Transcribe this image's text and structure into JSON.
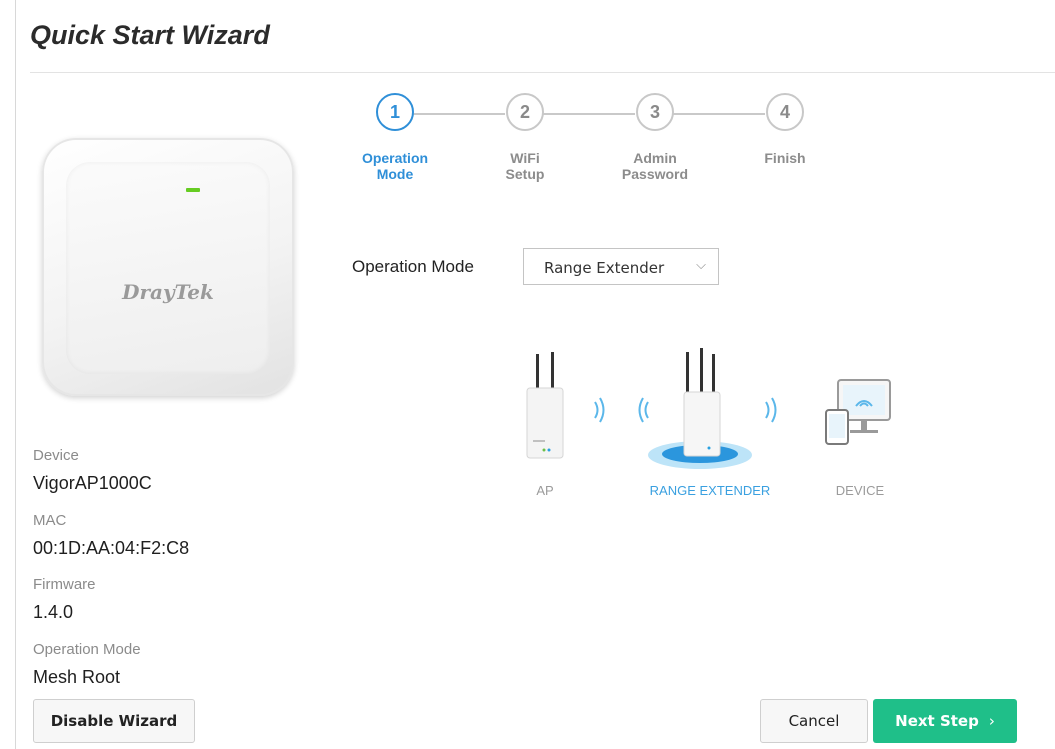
{
  "page": {
    "title": "Quick Start Wizard"
  },
  "device_image": {
    "logo_text": "DrayTek",
    "led_color": "#66cc22"
  },
  "info": [
    {
      "label": "Device",
      "value": "VigorAP1000C"
    },
    {
      "label": "MAC",
      "value": "00:1D:AA:04:F2:C8"
    },
    {
      "label": "Firmware",
      "value": "1.4.0"
    },
    {
      "label": "Operation Mode",
      "value": "Mesh Root"
    }
  ],
  "steps": [
    {
      "number": "1",
      "line1": "Operation",
      "line2": "Mode",
      "active": true
    },
    {
      "number": "2",
      "line1": "WiFi",
      "line2": "Setup",
      "active": false
    },
    {
      "number": "3",
      "line1": "Admin",
      "line2": "Password",
      "active": false
    },
    {
      "number": "4",
      "line1": "Finish",
      "line2": "",
      "active": false
    }
  ],
  "form": {
    "operation_mode_label": "Operation Mode",
    "operation_mode_value": "Range Extender"
  },
  "illustration": {
    "captions": [
      "AP",
      "RANGE EXTENDER",
      "DEVICE"
    ]
  },
  "buttons": {
    "disable_wizard": "Disable Wizard",
    "cancel": "Cancel",
    "next_step": "Next Step"
  },
  "colors": {
    "accent_blue": "#2f8fd8",
    "primary_green": "#1fbf89"
  }
}
